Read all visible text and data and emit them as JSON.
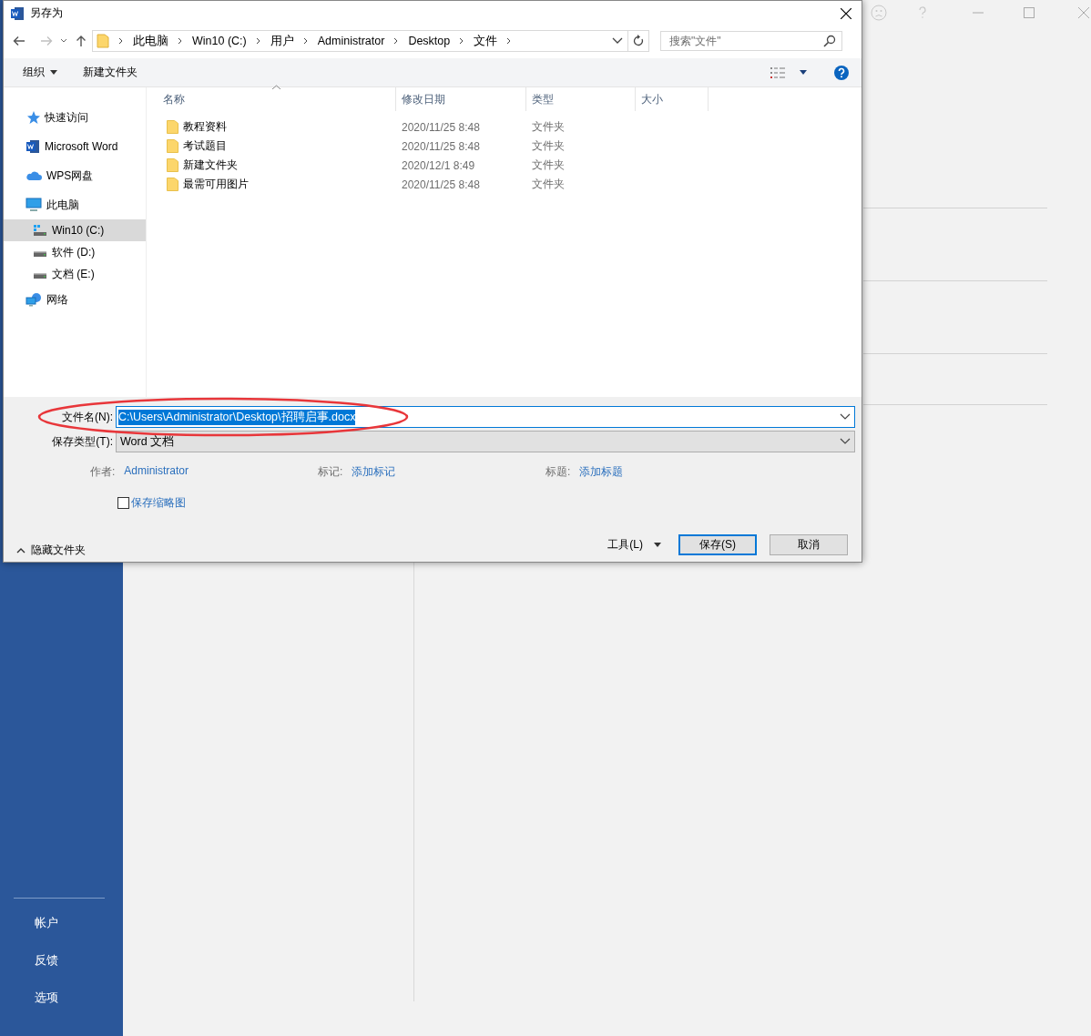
{
  "backdrop": {
    "sidebar_items": [
      {
        "label": "帐户"
      },
      {
        "label": "反馈"
      },
      {
        "label": "选项"
      }
    ]
  },
  "dialog": {
    "title": "另存为",
    "breadcrumbs": [
      "此电脑",
      "Win10 (C:)",
      "用户",
      "Administrator",
      "Desktop",
      "文件"
    ],
    "search": {
      "placeholder": "搜索\"文件\""
    },
    "toolbar": {
      "organize": "组织",
      "new_folder": "新建文件夹"
    },
    "nav": [
      {
        "label": "快速访问",
        "kind": "star",
        "selected": false
      },
      {
        "label": "Microsoft Word",
        "kind": "word",
        "selected": false
      },
      {
        "label": "WPS网盘",
        "kind": "cloud",
        "selected": false
      },
      {
        "label": "此电脑",
        "kind": "pc",
        "selected": false,
        "children": [
          {
            "label": "Win10 (C:)",
            "kind": "windrive",
            "selected": true
          },
          {
            "label": "软件 (D:)",
            "kind": "drive",
            "selected": false
          },
          {
            "label": "文档 (E:)",
            "kind": "drive",
            "selected": false
          }
        ]
      },
      {
        "label": "网络",
        "kind": "network",
        "selected": false
      }
    ],
    "columns": [
      "名称",
      "修改日期",
      "类型",
      "大小"
    ],
    "files": [
      {
        "name": "教程资料",
        "modified": "2020/11/25 8:48",
        "type": "文件夹"
      },
      {
        "name": "考试题目",
        "modified": "2020/11/25 8:48",
        "type": "文件夹"
      },
      {
        "name": "新建文件夹",
        "modified": "2020/12/1 8:49",
        "type": "文件夹"
      },
      {
        "name": "最需可用图片",
        "modified": "2020/11/25 8:48",
        "type": "文件夹"
      }
    ],
    "filename": {
      "label": "文件名(N):",
      "value": "C:\\Users\\Administrator\\Desktop\\招聘启事.docx"
    },
    "filetype": {
      "label": "保存类型(T):",
      "value": "Word 文档"
    },
    "metadata": [
      {
        "label": "作者:",
        "value": "Administrator"
      },
      {
        "label": "标记:",
        "value": "添加标记"
      },
      {
        "label": "标题:",
        "value": "添加标题"
      }
    ],
    "thumbnail": {
      "label": "保存缩略图",
      "checked": false
    },
    "hide_folders": "隐藏文件夹",
    "tools": "工具(L)",
    "buttons": [
      {
        "label": "保存(S)",
        "default": true
      },
      {
        "label": "取消",
        "default": false
      }
    ]
  }
}
